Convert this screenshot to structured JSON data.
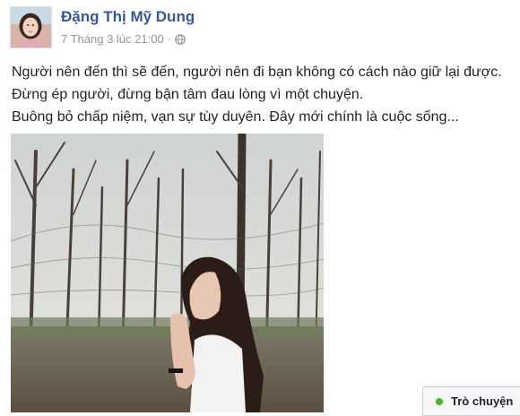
{
  "post": {
    "author": "Đặng Thị Mỹ Dung",
    "timestamp": "7 Tháng 3 lúc 21:00",
    "separator": "·",
    "privacy_icon": "globe-icon",
    "lines": [
      "Người nên đến thì sẽ đến, người nên đi bạn không có cách nào giữ lại được.",
      "Đừng ép người, đừng bận tâm đau lòng vì một chuyện.",
      "Buông bỏ chấp niệm, vạn sự tùy duyên. Đây mới chính là cuộc sống..."
    ]
  },
  "chat": {
    "label": "Trò chuyện",
    "status_color": "#42b72a"
  },
  "colors": {
    "link": "#365899",
    "meta": "#90949c",
    "text": "#1d2129"
  }
}
